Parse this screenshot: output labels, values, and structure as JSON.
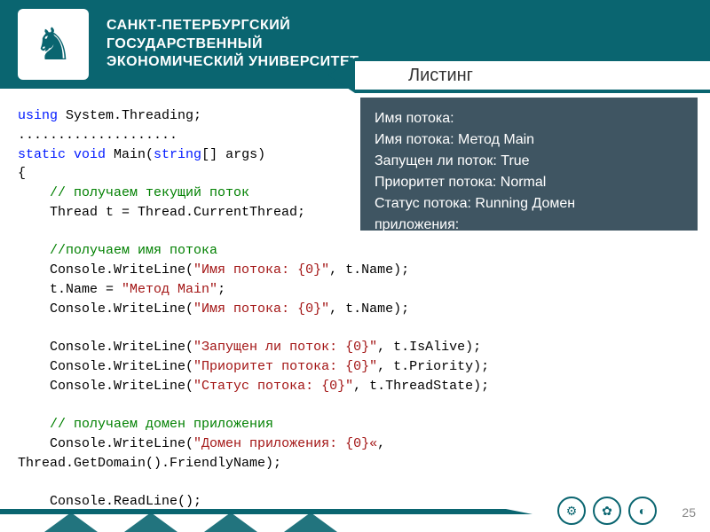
{
  "header": {
    "university_line1": "САНКТ-ПЕТЕРБУРГСКИЙ",
    "university_line2": "ГОСУДАРСТВЕННЫЙ",
    "university_line3": "ЭКОНОМИЧЕСКИЙ УНИВЕРСИТЕТ",
    "ribbon_title": "Листинг"
  },
  "code": {
    "using": "using",
    "namespace": " System.Threading;",
    "dots": "....................",
    "static": "static",
    "void": " void",
    "main": " Main(",
    "string": "string",
    "main_rest": "[] args)",
    "brace_open": "{",
    "c1": "    // получаем текущий поток",
    "l1a": "    Thread t = Thread.CurrentThread;",
    "c2": "    //получаем имя потока",
    "l2a": "    Console.WriteLine(",
    "s2a": "\"Имя потока: {0}\"",
    "l2b": ", t.Name);",
    "l3a": "    t.Name = ",
    "s3a": "\"Метод Main\"",
    "l3b": ";",
    "l4a": "    Console.WriteLine(",
    "s4a": "\"Имя потока: {0}\"",
    "l4b": ", t.Name);",
    "l5a": "    Console.WriteLine(",
    "s5a": "\"Запущен ли поток: {0}\"",
    "l5b": ", t.IsAlive);",
    "l6a": "    Console.WriteLine(",
    "s6a": "\"Приоритет потока: {0}\"",
    "l6b": ", t.Priority);",
    "l7a": "    Console.WriteLine(",
    "s7a": "\"Статус потока: {0}\"",
    "l7b": ", t.ThreadState);",
    "c3": "    // получаем домен приложения",
    "l8a": "    Console.WriteLine(",
    "s8a": "\"Домен приложения: {0}«",
    "l8b": ",",
    "l8c": "Thread.GetDomain().FriendlyName);",
    "l9": "    Console.ReadLine();"
  },
  "output": {
    "line1": "Имя потока:",
    "line2": "Имя потока: Метод Main",
    "line3": "Запущен ли поток: True",
    "line4": "Приоритет потока: Normal",
    "line5": "Статус потока: Running Домен",
    "line6": "приложения:"
  },
  "footer": {
    "page_number": "25"
  }
}
